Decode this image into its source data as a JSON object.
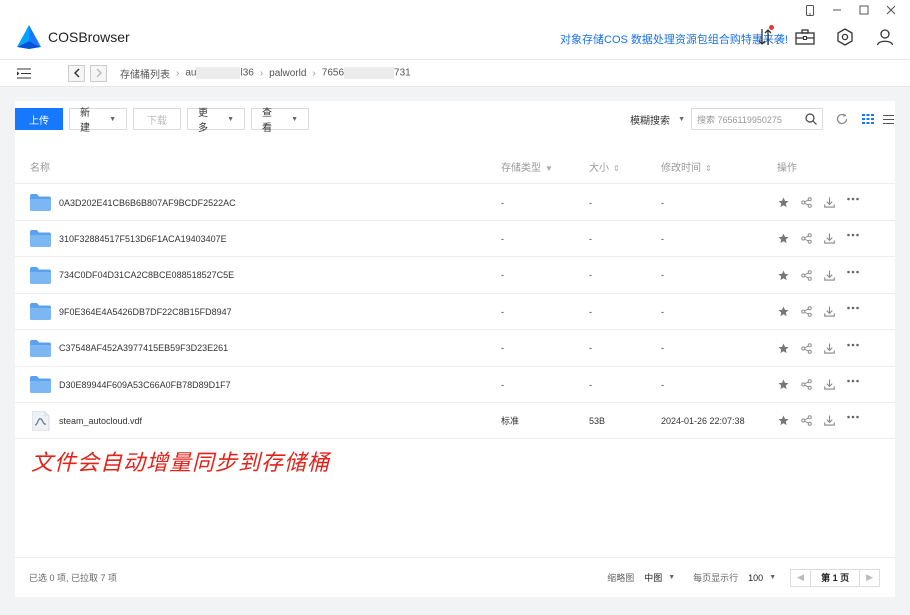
{
  "app": {
    "title": "COSBrowser",
    "promo": "对象存储COS 数据处理资源包组合购特惠来袭!"
  },
  "breadcrumb": {
    "root": "存储桶列表",
    "bucket_prefix": "au",
    "bucket_suffix": "l36",
    "folder": "palworld",
    "sub_prefix": "7656",
    "sub_suffix": "731"
  },
  "toolbar": {
    "upload": "上传",
    "new": "新建",
    "download": "下载",
    "more": "更多",
    "view": "查看",
    "search_mode": "模糊搜索",
    "search_placeholder": "搜索 7656119950275"
  },
  "table": {
    "headers": {
      "name": "名称",
      "storage": "存储类型",
      "size": "大小",
      "modified": "修改时间",
      "ops": "操作"
    },
    "rows": [
      {
        "name": "0A3D202E41CB6B6B807AF9BCDF2522AC",
        "storage": "-",
        "size": "-",
        "modified": "-",
        "kind": "folder"
      },
      {
        "name": "310F32884517F513D6F1ACA19403407E",
        "storage": "-",
        "size": "-",
        "modified": "-",
        "kind": "folder"
      },
      {
        "name": "734C0DF04D31CA2C8BCE088518527C5E",
        "storage": "-",
        "size": "-",
        "modified": "-",
        "kind": "folder"
      },
      {
        "name": "9F0E364E4A5426DB7DF22C8B15FD8947",
        "storage": "-",
        "size": "-",
        "modified": "-",
        "kind": "folder"
      },
      {
        "name": "C37548AF452A3977415EB59F3D23E261",
        "storage": "-",
        "size": "-",
        "modified": "-",
        "kind": "folder"
      },
      {
        "name": "D30E89944F609A53C66A0FB78D89D1F7",
        "storage": "-",
        "size": "-",
        "modified": "-",
        "kind": "folder"
      },
      {
        "name": "steam_autocloud.vdf",
        "storage": "标准",
        "size": "53B",
        "modified": "2024-01-26 22:07:38",
        "kind": "file"
      }
    ]
  },
  "annotation": "文件会自动增量同步到存储桶",
  "footer": {
    "status": "已选 0 项, 已拉取 7 项",
    "thumb_label": "缩略图",
    "thumb_value": "中图",
    "per_page_label": "每页显示行",
    "per_page_value": "100",
    "page": "第 1 页"
  },
  "colors": {
    "primary": "#1677ff",
    "annotation": "#e2231a",
    "folder": "#5aa2ee",
    "promo": "#1a73e8"
  }
}
